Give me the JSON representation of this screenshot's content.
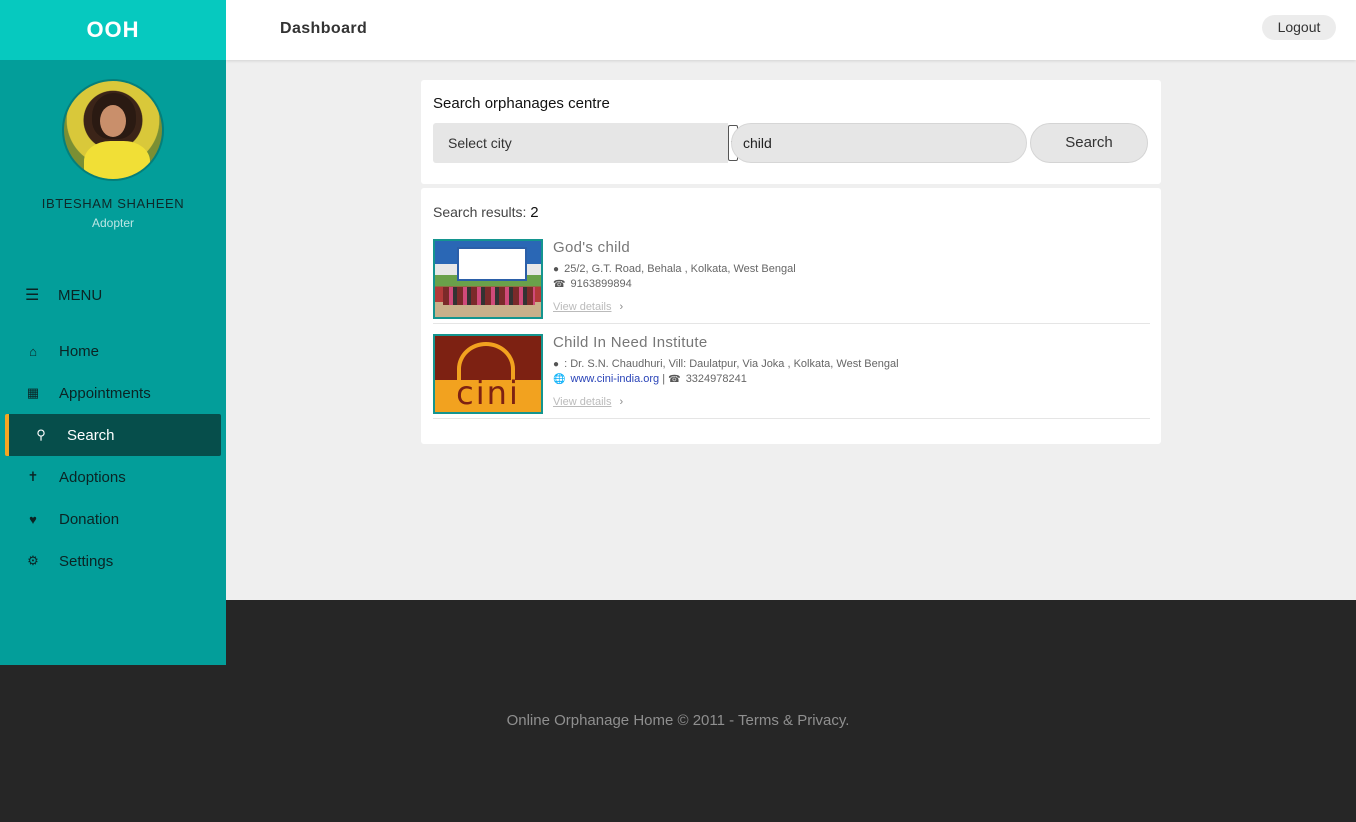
{
  "brand": "OOH",
  "user": {
    "name": "IBTESHAM SHAHEEN",
    "role": "Adopter"
  },
  "menu": {
    "title": "MENU",
    "items": [
      {
        "label": "Home",
        "icon": "home-icon"
      },
      {
        "label": "Appointments",
        "icon": "calendar-icon"
      },
      {
        "label": "Search",
        "icon": "search-icon",
        "active": true
      },
      {
        "label": "Adoptions",
        "icon": "child-icon"
      },
      {
        "label": "Donation",
        "icon": "heart-icon"
      },
      {
        "label": "Settings",
        "icon": "gear-icon"
      }
    ]
  },
  "header": {
    "title": "Dashboard",
    "logout_label": "Logout"
  },
  "search": {
    "title": "Search orphanages centre",
    "city_select": "Select city",
    "query": "child",
    "button_label": "Search"
  },
  "results": {
    "label": "Search results:",
    "count": "2",
    "items": [
      {
        "name": "God's child",
        "address": "25/2, G.T. Road, Behala , Kolkata, West Bengal",
        "phone": "9163899894",
        "details_label": "View details"
      },
      {
        "name": "Child In Need Institute",
        "address": ": Dr. S.N. Chaudhuri, Vill: Daulatpur, Via Joka , Kolkata, West Bengal",
        "website": "www.cini-india.org",
        "phone": "3324978241",
        "details_label": "View details",
        "logo_text": "cini"
      }
    ]
  },
  "footer": {
    "text": "Online Orphanage Home © 2011 - Terms & Privacy."
  },
  "colors": {
    "sidebar": "#039e9a",
    "brand_bar": "#06c9bf",
    "active_item": "#064e4b",
    "active_accent": "#f5a623",
    "footer": "#262626"
  }
}
